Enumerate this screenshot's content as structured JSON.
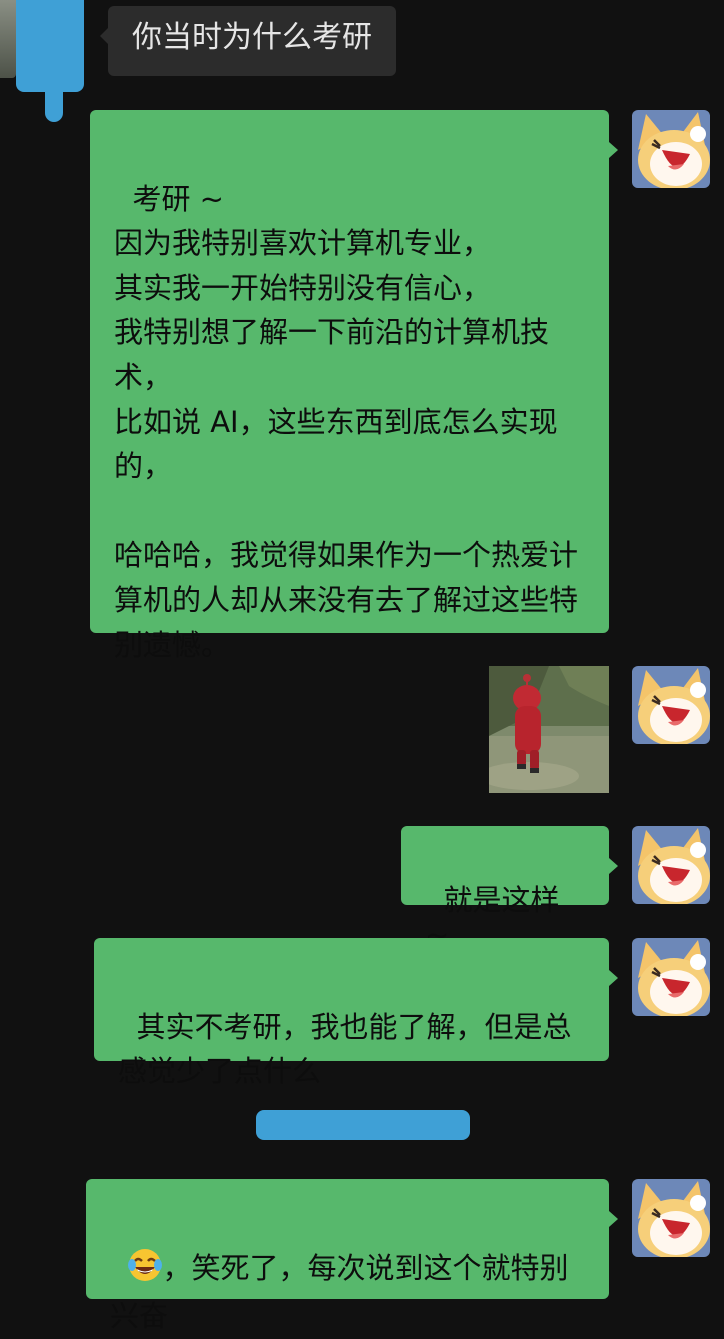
{
  "conversation": {
    "received": [
      {
        "text": "你当时为什么考研"
      }
    ],
    "sent": [
      {
        "text": "考研 ~\n因为我特别喜欢计算机专业，\n其实我一开始特别没有信心，\n我特别想了解一下前沿的计算机技术，\n比如说 AI，这些东西到底怎么实现的，\n\n哈哈哈，我觉得如果作为一个热爱计算机的人却从来没有去了解过这些特别遗憾。"
      },
      {
        "image": "red-character-walking-photo"
      },
      {
        "text": "就是这样 ~"
      },
      {
        "text": "其实不考研，我也能了解，但是总感觉少了点什么"
      },
      {
        "emoji": "tears-of-joy-emoji",
        "text": "，笑死了，每次说到这个就特别兴奋"
      }
    ]
  },
  "colors": {
    "background": "#111111",
    "sent_bubble": "#57b86c",
    "received_bubble": "#2c2c2c",
    "redaction": "#3fa0d6"
  }
}
